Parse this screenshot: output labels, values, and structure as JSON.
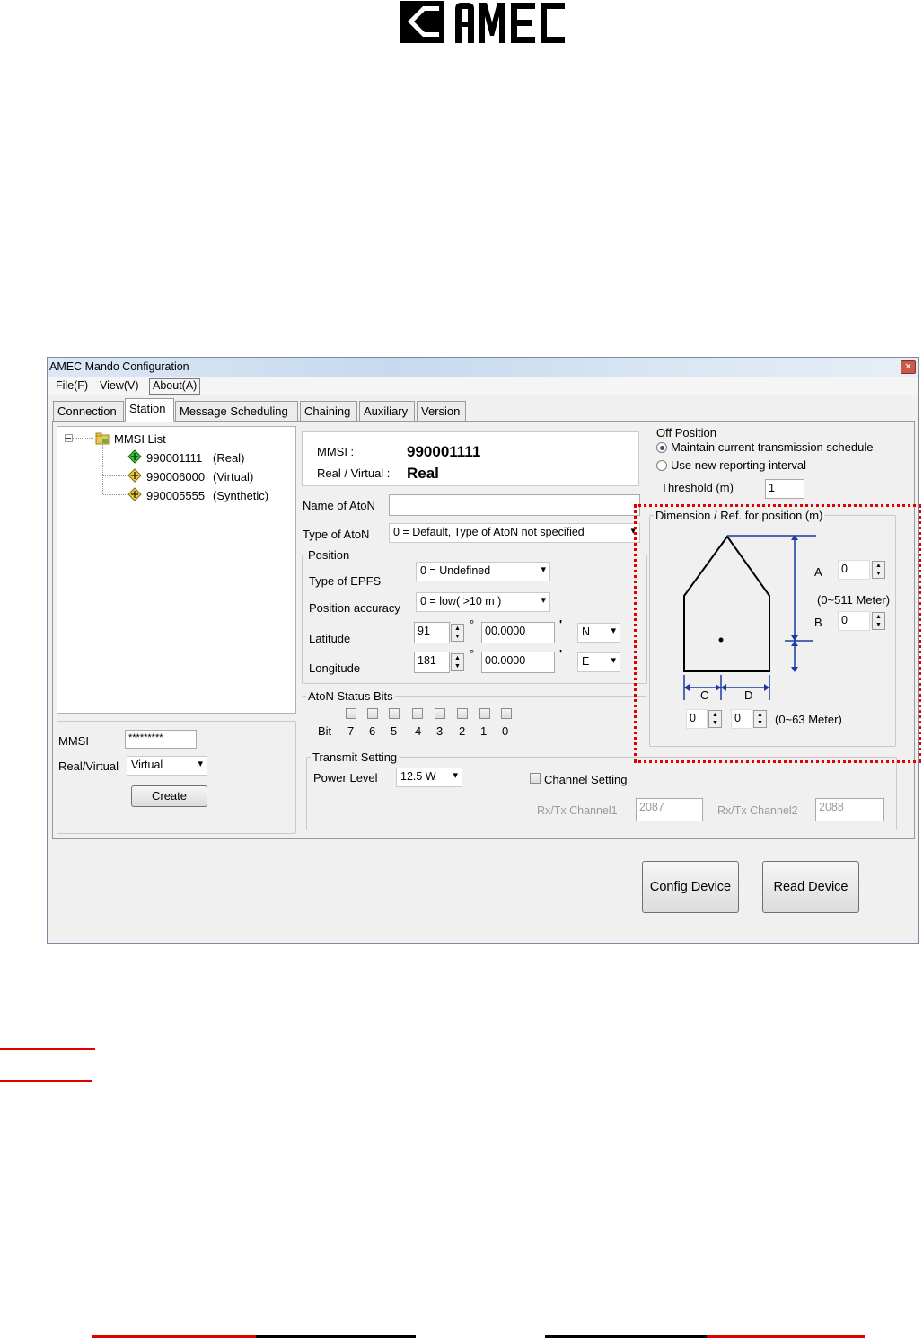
{
  "logo": {
    "text": "AMEC"
  },
  "window": {
    "title": "AMEC Mando Configuration",
    "close_icon": "close-icon",
    "menu": [
      {
        "label": "File(F)"
      },
      {
        "label": "View(V)"
      },
      {
        "label": "About(A)"
      }
    ],
    "tabs": [
      {
        "label": "Connection"
      },
      {
        "label": "Station"
      },
      {
        "label": "Message Scheduling"
      },
      {
        "label": "Chaining"
      },
      {
        "label": "Auxiliary"
      },
      {
        "label": "Version"
      }
    ],
    "selected_tab": "Station"
  },
  "tree": {
    "root": "MMSI List",
    "items": [
      {
        "mmsi": "990001111",
        "kind": "(Real)",
        "icon": "green-diamond-icon"
      },
      {
        "mmsi": "990006000",
        "kind": "(Virtual)",
        "icon": "yellow-diamond-icon"
      },
      {
        "mmsi": "990005555",
        "kind": "(Synthetic)",
        "icon": "yellow-diamond-icon"
      }
    ]
  },
  "create_form": {
    "mmsi_label": "MMSI",
    "mmsi_value": "*********",
    "rv_label": "Real/Virtual",
    "rv_value": "Virtual",
    "create_label": "Create"
  },
  "info": {
    "mmsi_label": "MMSI :",
    "mmsi_value": "990001111",
    "rv_label": "Real / Virtual :",
    "rv_value": "Real"
  },
  "aton": {
    "name_label": "Name of AtoN",
    "name_value": "",
    "type_label": "Type of AtoN",
    "type_value": "0 = Default, Type of AtoN not specified"
  },
  "position": {
    "title": "Position",
    "epfs_label": "Type of EPFS",
    "epfs_value": "0 = Undefined",
    "accuracy_label": "Position accuracy",
    "accuracy_value": "0 = low( >10 m )",
    "lat_label": "Latitude",
    "lat_deg": "91",
    "lat_min": "00.0000",
    "lat_dir": "N",
    "lon_label": "Longitude",
    "lon_deg": "181",
    "lon_min": "00.0000",
    "lon_dir": "E",
    "deg_symbol": "°",
    "min_symbol": "'"
  },
  "status_bits": {
    "title": "AtoN Status Bits",
    "bit_label": "Bit",
    "bits": [
      "7",
      "6",
      "5",
      "4",
      "3",
      "2",
      "1",
      "0"
    ]
  },
  "transmit": {
    "title": "Transmit Setting",
    "power_label": "Power Level",
    "power_value": "12.5 W",
    "channel_setting_label": "Channel Setting",
    "ch1_label": "Rx/Tx Channel1",
    "ch1_value": "2087",
    "ch2_label": "Rx/Tx Channel2",
    "ch2_value": "2088"
  },
  "off_position": {
    "title": "Off Position",
    "opt1": "Maintain current transmission schedule",
    "opt2": "Use new reporting interval",
    "selected": "Maintain current transmission schedule",
    "threshold_label": "Threshold (m)",
    "threshold_value": "1"
  },
  "dimension": {
    "title": "Dimension / Ref. for position (m)",
    "a_label": "A",
    "a_value": "0",
    "b_label": "B",
    "b_value": "0",
    "ab_range": "(0~511 Meter)",
    "c_label": "C",
    "c_value": "0",
    "d_label": "D",
    "d_value": "0",
    "cd_range": "(0~63 Meter)"
  },
  "buttons": {
    "config": "Config Device",
    "read": "Read Device"
  },
  "colors": {
    "highlight_red": "#e00000",
    "title_gradient": "#c7d9ee"
  }
}
